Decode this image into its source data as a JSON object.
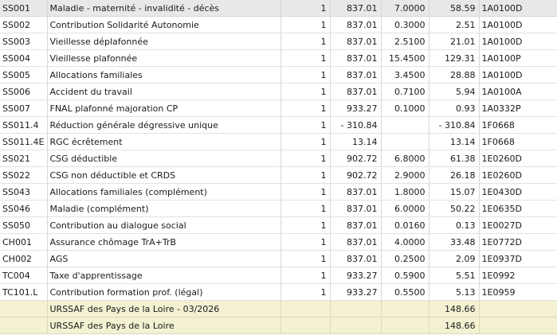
{
  "rows": [
    {
      "code": "SS001",
      "label": "Maladie - maternité - invalidité - décès",
      "qty": "1",
      "base": "837.01",
      "rate": "7.0000",
      "amount": "58.59",
      "account": "1A0100D"
    },
    {
      "code": "SS002",
      "label": "Contribution Solidarité Autonomie",
      "qty": "1",
      "base": "837.01",
      "rate": "0.3000",
      "amount": "2.51",
      "account": "1A0100D"
    },
    {
      "code": "SS003",
      "label": "Vieillesse déplafonnée",
      "qty": "1",
      "base": "837.01",
      "rate": "2.5100",
      "amount": "21.01",
      "account": "1A0100D"
    },
    {
      "code": "SS004",
      "label": "Vieillesse plafonnée",
      "qty": "1",
      "base": "837.01",
      "rate": "15.4500",
      "amount": "129.31",
      "account": "1A0100P"
    },
    {
      "code": "SS005",
      "label": "Allocations familiales",
      "qty": "1",
      "base": "837.01",
      "rate": "3.4500",
      "amount": "28.88",
      "account": "1A0100D"
    },
    {
      "code": "SS006",
      "label": "Accident du travail",
      "qty": "1",
      "base": "837.01",
      "rate": "0.7100",
      "amount": "5.94",
      "account": "1A0100A"
    },
    {
      "code": "SS007",
      "label": "FNAL plafonné majoration CP",
      "qty": "1",
      "base": "933.27",
      "rate": "0.1000",
      "amount": "0.93",
      "account": "1A0332P"
    },
    {
      "code": "SS011.4",
      "label": "Réduction générale dégressive unique",
      "qty": "1",
      "base": "- 310.84",
      "rate": "",
      "amount": "- 310.84",
      "account": "1F0668"
    },
    {
      "code": "SS011.4E",
      "label": "RGC écrêtement",
      "qty": "1",
      "base": "13.14",
      "rate": "",
      "amount": "13.14",
      "account": "1F0668"
    },
    {
      "code": "SS021",
      "label": "CSG déductible",
      "qty": "1",
      "base": "902.72",
      "rate": "6.8000",
      "amount": "61.38",
      "account": "1E0260D"
    },
    {
      "code": "SS022",
      "label": "CSG non déductible et CRDS",
      "qty": "1",
      "base": "902.72",
      "rate": "2.9000",
      "amount": "26.18",
      "account": "1E0260D"
    },
    {
      "code": "SS043",
      "label": "Allocations familiales (complément)",
      "qty": "1",
      "base": "837.01",
      "rate": "1.8000",
      "amount": "15.07",
      "account": "1E0430D"
    },
    {
      "code": "SS046",
      "label": "Maladie (complément)",
      "qty": "1",
      "base": "837.01",
      "rate": "6.0000",
      "amount": "50.22",
      "account": "1E0635D"
    },
    {
      "code": "SS050",
      "label": "Contribution au dialogue social",
      "qty": "1",
      "base": "837.01",
      "rate": "0.0160",
      "amount": "0.13",
      "account": "1E0027D"
    },
    {
      "code": "CH001",
      "label": "Assurance chômage TrA+TrB",
      "qty": "1",
      "base": "837.01",
      "rate": "4.0000",
      "amount": "33.48",
      "account": "1E0772D"
    },
    {
      "code": "CH002",
      "label": "AGS",
      "qty": "1",
      "base": "837.01",
      "rate": "0.2500",
      "amount": "2.09",
      "account": "1E0937D"
    },
    {
      "code": "TC004",
      "label": "Taxe d'apprentissage",
      "qty": "1",
      "base": "933.27",
      "rate": "0.5900",
      "amount": "5.51",
      "account": "1E0992"
    },
    {
      "code": "TC101.L",
      "label": "Contribution formation prof. (légal)",
      "qty": "1",
      "base": "933.27",
      "rate": "0.5500",
      "amount": "5.13",
      "account": "1E0959"
    }
  ],
  "totals": [
    {
      "label": "URSSAF des Pays de la Loire - 03/2026",
      "amount": "148.66"
    },
    {
      "label": "URSSAF des Pays de la Loire",
      "amount": "148.66"
    }
  ]
}
